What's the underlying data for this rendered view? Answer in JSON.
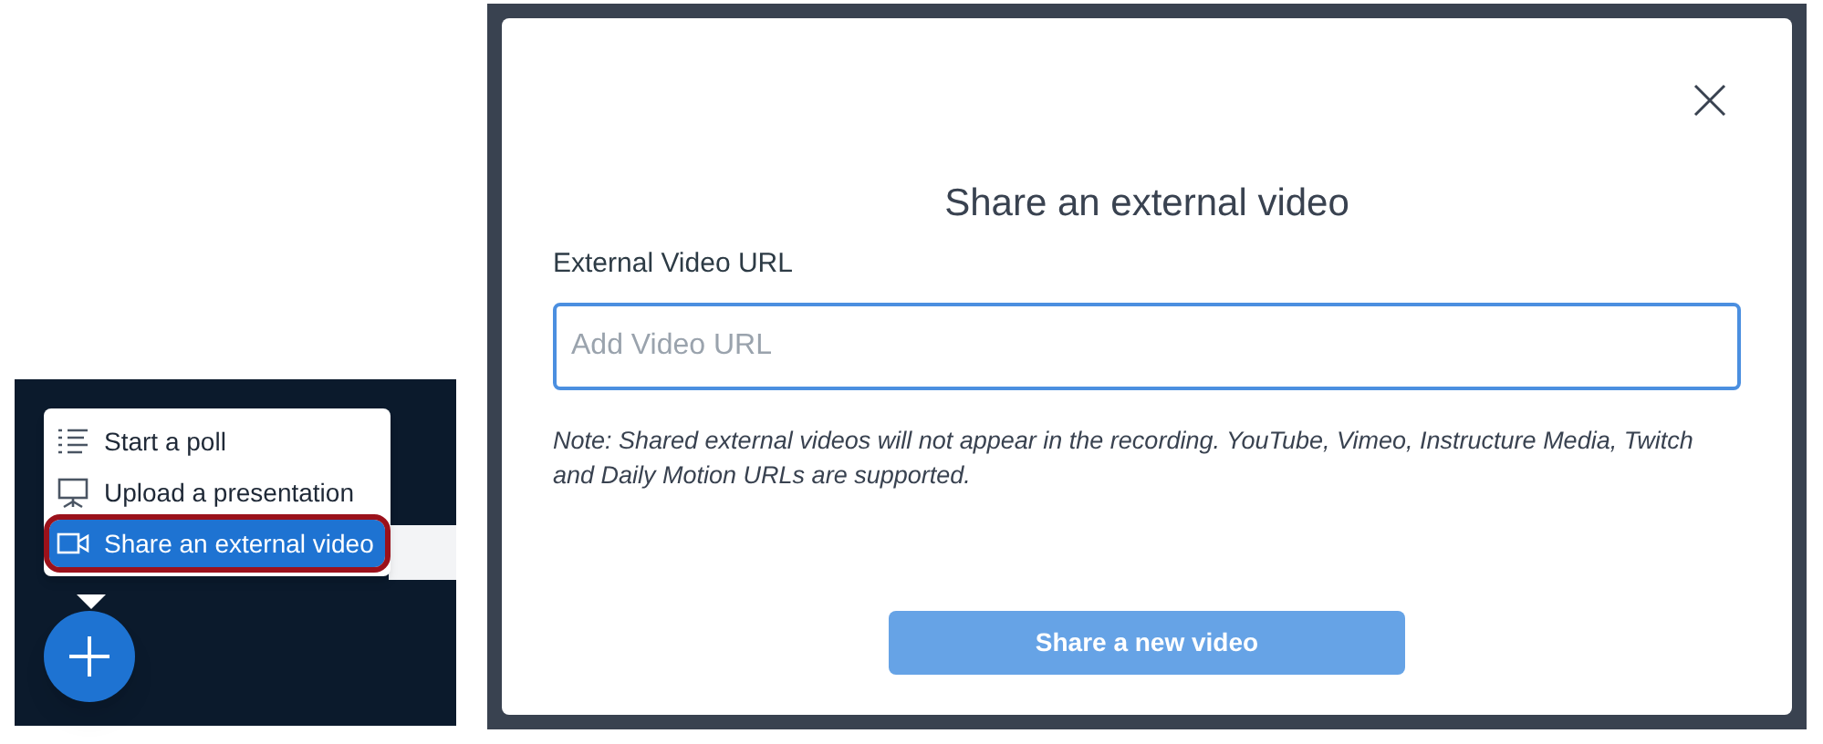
{
  "menu": {
    "items": [
      {
        "kind": "poll",
        "label": "Start a poll",
        "selected": false
      },
      {
        "kind": "presentation",
        "label": "Upload a presentation",
        "selected": false
      },
      {
        "kind": "video",
        "label": "Share an external video",
        "selected": true
      }
    ]
  },
  "modal": {
    "title": "Share an external video",
    "field_label": "External Video URL",
    "placeholder": "Add Video URL",
    "note": "Note: Shared external videos will not appear in the recording. YouTube, Vimeo, Instructure Media, Twitch and Daily Motion URLs are supported.",
    "button": "Share a new video"
  }
}
